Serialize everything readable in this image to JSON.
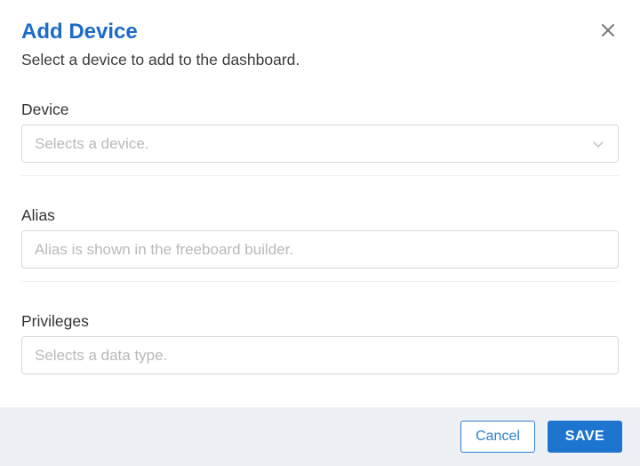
{
  "header": {
    "title": "Add Device",
    "subtitle": "Select a device to add to the dashboard."
  },
  "fields": {
    "device": {
      "label": "Device",
      "placeholder": "Selects a device."
    },
    "alias": {
      "label": "Alias",
      "placeholder": "Alias is shown in the freeboard builder."
    },
    "privileges": {
      "label": "Privileges",
      "placeholder": "Selects a data type."
    }
  },
  "footer": {
    "cancel": "Cancel",
    "save": "SAVE"
  }
}
